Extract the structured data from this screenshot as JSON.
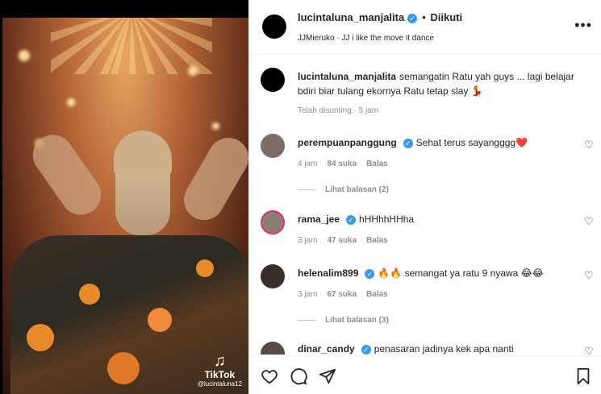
{
  "media": {
    "watermark_logo": "TikTok",
    "watermark_user": "@lucintaluna12"
  },
  "post": {
    "author": "lucintaluna_manjalita",
    "separator": "•",
    "follow_label": "Diikuti",
    "audio": "JJMieruko · JJ i like the move it dance",
    "more_label": "•••"
  },
  "caption": {
    "username": "lucintaluna_manjalita",
    "text": "semangatin Ratu yah guys ... lagi belajar bdiri biar tulang ekornya Ratu tetap slay 💃",
    "edited": "Telah disunting · 5 jam"
  },
  "comments": [
    {
      "username": "perempuanpanggung",
      "text": "Sehat terus sayangggg❤️",
      "time": "4 jam",
      "likes": "84 suka",
      "reply": "Balas",
      "view_replies": "Lihat balasan (2)",
      "avatar_color": "#7d6d66"
    },
    {
      "username": "rama_jee",
      "text": "hHHhhHHha",
      "time": "3 jam",
      "likes": "47 suka",
      "reply": "Balas",
      "view_replies": "",
      "avatar_color": "#8a7f70"
    },
    {
      "username": "helenalim899",
      "text": "🔥🔥 semangat ya ratu 9 nyawa 😂😂",
      "time": "3 jam",
      "likes": "67 suka",
      "reply": "Balas",
      "view_replies": "Lihat balasan (3)",
      "avatar_color": "#3a2e2a"
    },
    {
      "username": "dinar_candy",
      "text": "penasaran jadinya kek apa nanti",
      "time": "",
      "likes": "",
      "reply": "",
      "view_replies": "",
      "avatar_color": "#5a4a44"
    }
  ],
  "icons": {
    "like": "heart-icon",
    "comment": "comment-icon",
    "share": "paper-plane-icon",
    "save": "bookmark-icon",
    "verified": "verified-badge-icon",
    "more": "more-options-icon"
  },
  "colors": {
    "verified": "#3897f0",
    "muted_text": "#8e8e8e",
    "text": "#262626"
  }
}
